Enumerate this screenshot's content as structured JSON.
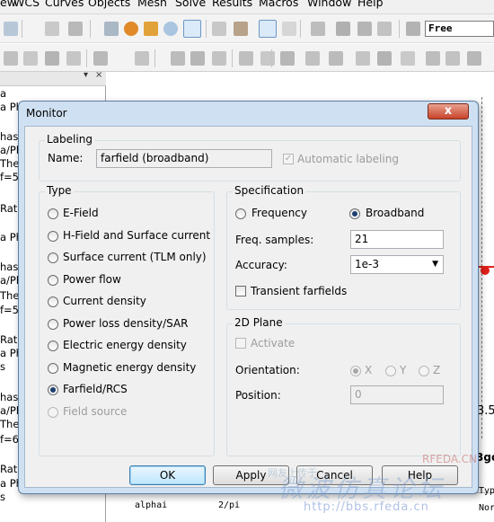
{
  "menubar": {
    "items": [
      "ew",
      "WCS",
      "Curves",
      "Objects",
      "Mesh",
      "Solve",
      "Results",
      "Macros",
      "Window",
      "Help"
    ]
  },
  "toolbar": {
    "mode_combo_value": "Free"
  },
  "tree": {
    "items": [
      "a",
      "a Ph",
      "hase",
      "a/Ph",
      "Thet",
      "f=5]",
      "Rati",
      "a Ph",
      "hase",
      "a/Ph",
      "Thet",
      "f=5.",
      "Rati",
      "a Ph",
      "s",
      "hase",
      "a/Ph",
      "Thet",
      "f=6]",
      "Rati",
      "a Ph",
      "s"
    ]
  },
  "plot": {
    "tick_label": "3.5",
    "side_label": "3gc"
  },
  "table": {
    "cells": [
      "alphai",
      "2/pi",
      "Nor",
      "Typ"
    ]
  },
  "watermark": {
    "line1": "网友上传于",
    "line2": "微波仿真论坛",
    "line3": "http://bbs.rfeda.cn",
    "line4": "RFEDA.CN"
  },
  "dialog": {
    "title": "Monitor",
    "close_glyph": "x",
    "labeling": {
      "title": "Labeling",
      "name_label": "Name:",
      "name_value": "farfield (broadband)",
      "auto_label": "Automatic labeling",
      "auto_checked": true
    },
    "type": {
      "title": "Type",
      "options": [
        "E-Field",
        "H-Field and Surface current",
        "Surface current (TLM only)",
        "Power flow",
        "Current density",
        "Power loss density/SAR",
        "Electric energy density",
        "Magnetic energy density",
        "Farfield/RCS",
        "Field source"
      ],
      "selected": "Farfield/RCS"
    },
    "specification": {
      "title": "Specification",
      "frequency_label": "Frequency",
      "broadband_label": "Broadband",
      "selected": "Broadband",
      "freq_samples_label": "Freq. samples:",
      "freq_samples_value": "21",
      "accuracy_label": "Accuracy:",
      "accuracy_value": "1e-3",
      "transient_label": "Transient farfields",
      "transient_checked": false
    },
    "plane2d": {
      "title": "2D Plane",
      "activate_label": "Activate",
      "orientation_label": "Orientation:",
      "orientation_options": [
        "X",
        "Y",
        "Z"
      ],
      "orientation_selected": "X",
      "position_label": "Position:",
      "position_value": "0"
    },
    "buttons": {
      "ok": "OK",
      "apply": "Apply",
      "cancel": "Cancel",
      "help": "Help"
    }
  }
}
